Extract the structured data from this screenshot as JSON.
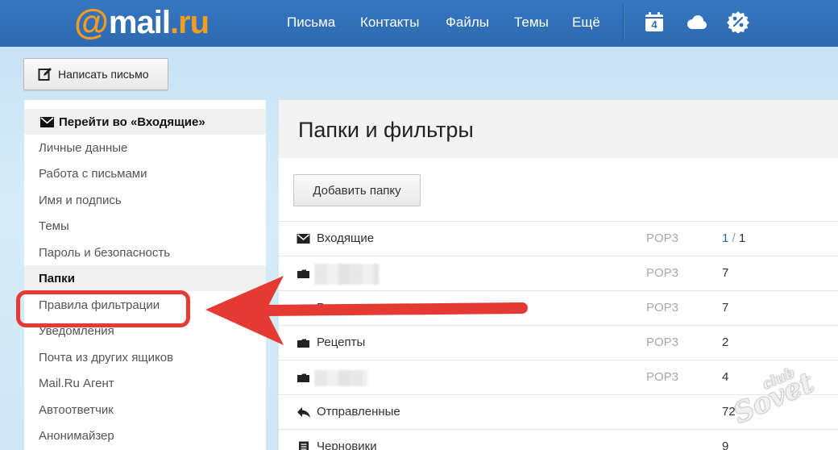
{
  "logo": {
    "at": "@",
    "name": "mail",
    "domain": ".ru"
  },
  "nav": {
    "items": [
      "Письма",
      "Контакты",
      "Файлы",
      "Темы",
      "Ещё"
    ],
    "calendar_day": "4",
    "icons": [
      "calendar-icon",
      "cloud-icon",
      "discount-icon"
    ]
  },
  "compose": {
    "label": "Написать письмо"
  },
  "sidebar": {
    "goto_inbox": "Перейти во «Входящие»",
    "items": [
      "Личные данные",
      "Работа с письмами",
      "Имя и подпись",
      "Темы",
      "Пароль и безопасность",
      "Папки",
      "Правила фильтрации",
      "Уведомления",
      "Почта из других ящиков",
      "Mail.Ru Агент",
      "Автоответчик",
      "Анонимайзер"
    ],
    "active": "Папки",
    "highlighted": "Правила фильтрации"
  },
  "main": {
    "title": "Папки и фильтры",
    "add_folder": "Добавить папку",
    "folders": [
      {
        "name": "Входящие",
        "icon": "envelope-icon",
        "proto": "POP3",
        "unread": "1",
        "total": "1"
      },
      {
        "name": "",
        "icon": "folder-icon",
        "proto": "POP3",
        "count": "7",
        "blurred": true
      },
      {
        "name": "Регистрация",
        "icon": "folder-icon",
        "proto": "POP3",
        "count": "7"
      },
      {
        "name": "Рецепты",
        "icon": "folder-icon",
        "proto": "POP3",
        "count": "2"
      },
      {
        "name": "",
        "icon": "folder-icon",
        "proto": "POP3",
        "count": "4",
        "blurred": true
      },
      {
        "name": "Отправленные",
        "icon": "reply-icon",
        "proto": "",
        "count": "72"
      },
      {
        "name": "Черновики",
        "icon": "draft-icon",
        "proto": "",
        "count": "9"
      }
    ]
  },
  "colors": {
    "topbar": "#2f6fb7",
    "logo_accent": "#f39c1f",
    "highlight": "#e53a33",
    "unread": "#2a64ab"
  },
  "watermark": {
    "line1": "club",
    "line2": "Sovet"
  }
}
